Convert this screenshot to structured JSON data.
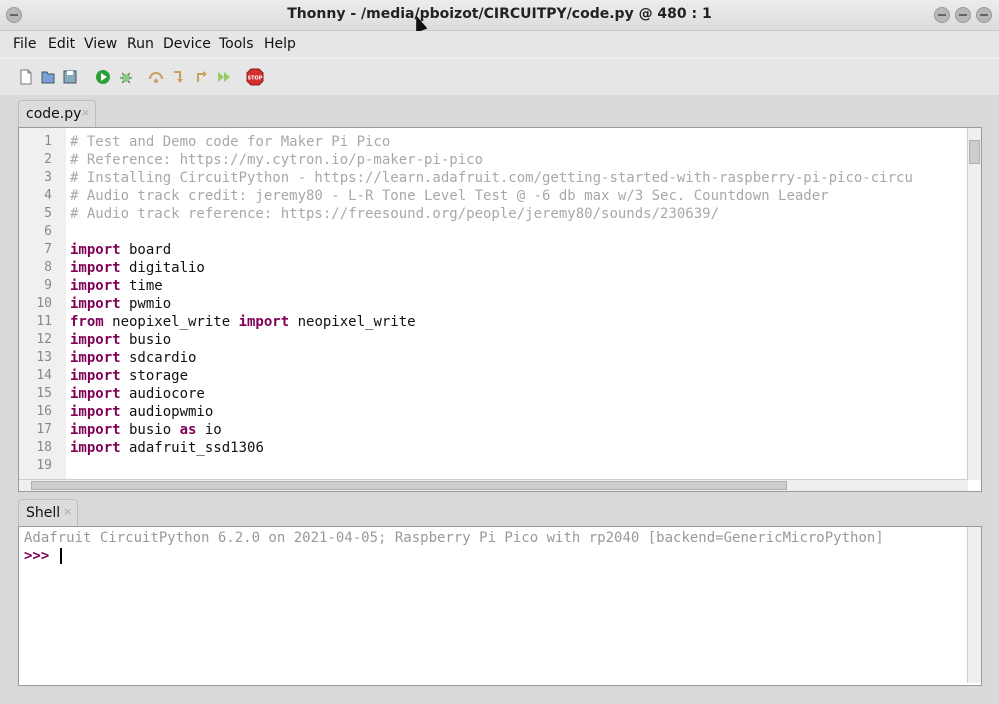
{
  "window": {
    "title": "Thonny  -  /media/pboizot/CIRCUITPY/code.py  @  480 : 1"
  },
  "menu": [
    "File",
    "Edit",
    "View",
    "Run",
    "Device",
    "Tools",
    "Help"
  ],
  "toolbar": [
    "new-file-icon",
    "open-file-icon",
    "save-file-icon",
    "run-icon",
    "debug-icon",
    "step-over-icon",
    "step-into-icon",
    "step-out-icon",
    "resume-icon",
    "stop-icon"
  ],
  "editor": {
    "tab_label": "code.py",
    "lines": [
      {
        "n": "1",
        "parts": [
          [
            "cm",
            "# Test and Demo code for Maker Pi Pico"
          ]
        ]
      },
      {
        "n": "2",
        "parts": [
          [
            "cm",
            "# Reference: https://my.cytron.io/p-maker-pi-pico"
          ]
        ]
      },
      {
        "n": "3",
        "parts": [
          [
            "cm",
            "# Installing CircuitPython - https://learn.adafruit.com/getting-started-with-raspberry-pi-pico-circu"
          ]
        ]
      },
      {
        "n": "4",
        "parts": [
          [
            "cm",
            "# Audio track credit: jeremy80 - L-R Tone Level Test @ -6 db max w/3 Sec. Countdown Leader"
          ]
        ]
      },
      {
        "n": "5",
        "parts": [
          [
            "cm",
            "# Audio track reference: https://freesound.org/people/jeremy80/sounds/230639/"
          ]
        ]
      },
      {
        "n": "6",
        "parts": []
      },
      {
        "n": "7",
        "parts": [
          [
            "kw",
            "import"
          ],
          [
            "pl",
            " board"
          ]
        ]
      },
      {
        "n": "8",
        "parts": [
          [
            "kw",
            "import"
          ],
          [
            "pl",
            " digitalio"
          ]
        ]
      },
      {
        "n": "9",
        "parts": [
          [
            "kw",
            "import"
          ],
          [
            "pl",
            " time"
          ]
        ]
      },
      {
        "n": "10",
        "parts": [
          [
            "kw",
            "import"
          ],
          [
            "pl",
            " pwmio"
          ]
        ]
      },
      {
        "n": "11",
        "parts": [
          [
            "kw",
            "from"
          ],
          [
            "pl",
            " neopixel_write "
          ],
          [
            "kw",
            "import"
          ],
          [
            "pl",
            " neopixel_write"
          ]
        ]
      },
      {
        "n": "12",
        "parts": [
          [
            "kw",
            "import"
          ],
          [
            "pl",
            " busio"
          ]
        ]
      },
      {
        "n": "13",
        "parts": [
          [
            "kw",
            "import"
          ],
          [
            "pl",
            " sdcardio"
          ]
        ]
      },
      {
        "n": "14",
        "parts": [
          [
            "kw",
            "import"
          ],
          [
            "pl",
            " storage"
          ]
        ]
      },
      {
        "n": "15",
        "parts": [
          [
            "kw",
            "import"
          ],
          [
            "pl",
            " audiocore"
          ]
        ]
      },
      {
        "n": "16",
        "parts": [
          [
            "kw",
            "import"
          ],
          [
            "pl",
            " audiopwmio"
          ]
        ]
      },
      {
        "n": "17",
        "parts": [
          [
            "kw",
            "import"
          ],
          [
            "pl",
            " busio "
          ],
          [
            "kw",
            "as"
          ],
          [
            "pl",
            " io"
          ]
        ]
      },
      {
        "n": "18",
        "parts": [
          [
            "kw",
            "import"
          ],
          [
            "pl",
            " adafruit_ssd1306"
          ]
        ]
      },
      {
        "n": "19",
        "parts": []
      }
    ]
  },
  "shell": {
    "tab_label": "Shell",
    "banner": "Adafruit CircuitPython 6.2.0 on 2021-04-05; Raspberry Pi Pico with rp2040 [backend=GenericMicroPython]",
    "prompt": ">>>"
  },
  "colors": {
    "comment": "#a8a8a8",
    "keyword": "#7f0055",
    "stop": "#d32f2f",
    "run": "#2e9e3a"
  }
}
